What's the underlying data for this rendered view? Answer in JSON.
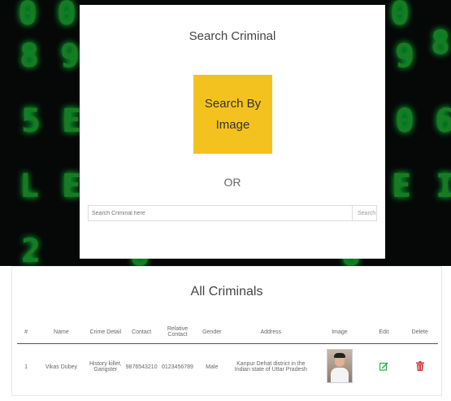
{
  "search_panel": {
    "title": "Search Criminal",
    "search_by_image_label": "Search By Image",
    "or_label": "OR",
    "search_input_placeholder": "Search Criminal here",
    "search_button_label": "Search"
  },
  "criminals": {
    "title": "All Criminals",
    "columns": [
      "#",
      "Name",
      "Crime Detail",
      "Contact",
      "Relative Contact",
      "Gender",
      "Address",
      "Image",
      "Edit",
      "Delete"
    ],
    "rows": [
      {
        "index": "1",
        "name": "Vikas Dubey",
        "crime_detail": "History killer, Gangster",
        "contact": "9876543210",
        "relative_contact": "0123456789",
        "gender": "Male",
        "address": "Kanpur Dehat district in the Indian state of Uttar Pradesh",
        "image_icon": "person-photo",
        "edit_icon": "edit-icon",
        "delete_icon": "trash-icon"
      }
    ]
  },
  "colors": {
    "accent_yellow": "#f4c21f",
    "matrix_green": "#1d8f2a",
    "edit_green": "#2aa84a",
    "delete_red": "#d9363e"
  }
}
